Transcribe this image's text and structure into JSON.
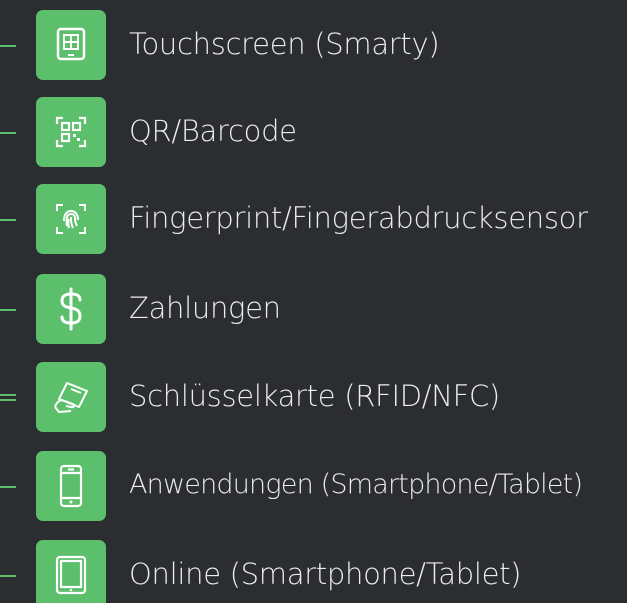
{
  "accent": "#5bbf6b",
  "background": "#2b2d30",
  "items": [
    {
      "label": "Touchscreen (Smarty)",
      "icon": "touchscreen-icon"
    },
    {
      "label": "QR/Barcode",
      "icon": "qr-barcode-icon"
    },
    {
      "label": "Fingerprint/Fingerabdrucksensor",
      "icon": "fingerprint-icon"
    },
    {
      "label": "Zahlungen",
      "icon": "dollar-icon"
    },
    {
      "label": "Schlüsselkarte (RFID/NFC)",
      "icon": "keycard-icon"
    },
    {
      "label": "Anwendungen (Smartphone/Tablet)",
      "icon": "smartphone-icon"
    },
    {
      "label": "Online (Smartphone/Tablet)",
      "icon": "tablet-icon"
    }
  ]
}
